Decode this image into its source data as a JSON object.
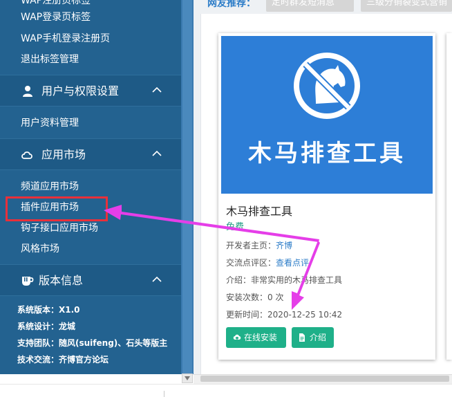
{
  "sidebar": {
    "top_cut_item": "WAP注册页标签",
    "items_top": [
      "WAP登录页标签",
      "WAP手机登录注册页",
      "退出标签管理"
    ],
    "section_users": {
      "label": "用户与权限设置",
      "icon": "user-icon",
      "items": [
        "用户资料管理"
      ]
    },
    "section_market": {
      "label": "应用市场",
      "icon": "cloud-icon",
      "items": [
        "频道应用市场",
        "插件应用市场",
        "钩子接口应用市场",
        "风格市场"
      ]
    },
    "section_version": {
      "label": "版本信息",
      "icon": "cup-icon"
    },
    "info": {
      "version_label": "系统版本：",
      "version_value": "X1.0",
      "design_label": "系统设计：",
      "design_value": "龙城",
      "team_label": "支持团队：",
      "team_value": "随风(suifeng)、石头等版主",
      "forum_label": "技术交流：",
      "forum_value": "齐博官方论坛"
    }
  },
  "main": {
    "recommend_label": "网友推荐：",
    "tags": [
      "定时群发短消息",
      "三级分销裂变式营销"
    ],
    "card": {
      "banner_text": "木马排查工具",
      "title": "木马排查工具",
      "price": "免费",
      "developer_label": "开发者主页：",
      "developer_value": "齐博",
      "review_label": "交流点评区：",
      "review_value": "查看点评",
      "intro": "介绍：非常实用的木马排查工具",
      "installs": "安装次数：0 次",
      "updated": "更新时间：2020-12-25 10:42",
      "install_button": "在线安装",
      "intro_button": "介绍"
    }
  },
  "colors": {
    "sidebar_bg": "#236290",
    "accent_green": "#1fb089",
    "banner_blue": "#2d7ed7",
    "highlight_red": "#e8303a",
    "arrow_magenta": "#e53ee8"
  }
}
